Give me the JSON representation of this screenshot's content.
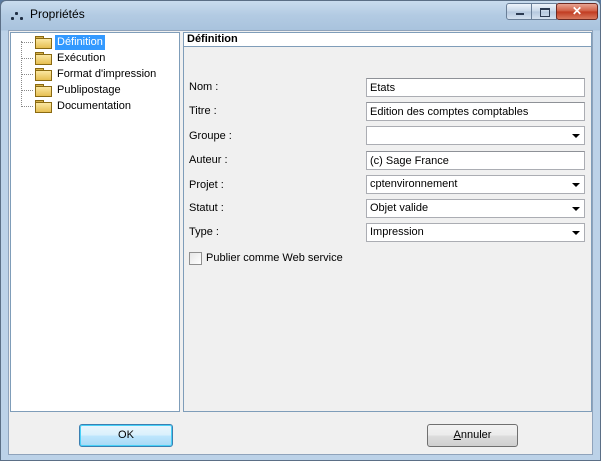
{
  "window": {
    "title": "Propriétés",
    "close_glyph": "✕"
  },
  "tree": {
    "items": [
      {
        "label": "Définition",
        "selected": true
      },
      {
        "label": "Exécution",
        "selected": false
      },
      {
        "label": "Format d'impression",
        "selected": false
      },
      {
        "label": "Publipostage",
        "selected": false
      },
      {
        "label": "Documentation",
        "selected": false
      }
    ]
  },
  "panel": {
    "header": "Définition",
    "fields": {
      "nom": {
        "label": "Nom :",
        "value": "Etats"
      },
      "titre": {
        "label": "Titre :",
        "value": "Edition des comptes comptables"
      },
      "groupe": {
        "label": "Groupe :",
        "value": ""
      },
      "auteur": {
        "label": "Auteur :",
        "value": "(c) Sage France"
      },
      "projet": {
        "label": "Projet :",
        "value": "cptenvironnement"
      },
      "statut": {
        "label": "Statut :",
        "value": "Objet valide"
      },
      "type": {
        "label": "Type :",
        "value": "Impression"
      }
    },
    "web_service": {
      "label": "Publier comme Web service",
      "checked": false
    }
  },
  "buttons": {
    "ok": "OK",
    "cancel_first": "A",
    "cancel_rest": "nnuler"
  },
  "colors": {
    "selection": "#3399ff",
    "close_button": "#c0391f"
  }
}
